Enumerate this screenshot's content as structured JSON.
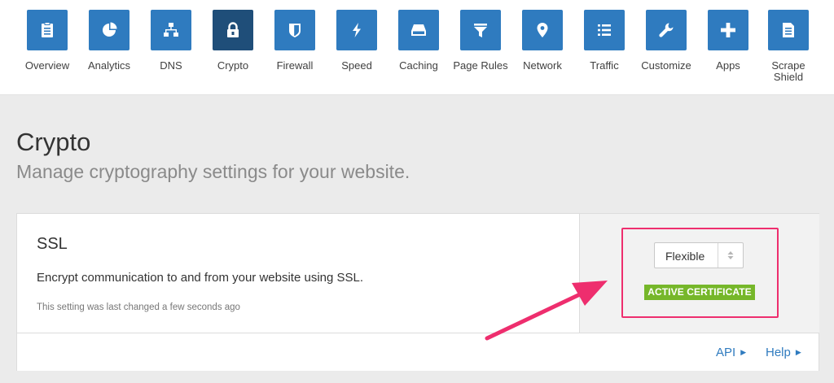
{
  "nav": {
    "items": [
      {
        "label": "Overview",
        "icon": "clipboard-icon"
      },
      {
        "label": "Analytics",
        "icon": "pie-chart-icon"
      },
      {
        "label": "DNS",
        "icon": "sitemap-icon"
      },
      {
        "label": "Crypto",
        "icon": "lock-icon"
      },
      {
        "label": "Firewall",
        "icon": "shield-icon"
      },
      {
        "label": "Speed",
        "icon": "lightning-icon"
      },
      {
        "label": "Caching",
        "icon": "hard-drive-icon"
      },
      {
        "label": "Page Rules",
        "icon": "filter-icon"
      },
      {
        "label": "Network",
        "icon": "map-pin-icon"
      },
      {
        "label": "Traffic",
        "icon": "list-icon"
      },
      {
        "label": "Customize",
        "icon": "wrench-icon"
      },
      {
        "label": "Apps",
        "icon": "plus-icon"
      },
      {
        "label": "Scrape Shield",
        "icon": "document-icon"
      }
    ],
    "active": "Crypto"
  },
  "page": {
    "title": "Crypto",
    "subtitle": "Manage cryptography settings for your website."
  },
  "ssl_card": {
    "title": "SSL",
    "description": "Encrypt communication to and from your website using SSL.",
    "last_changed": "This setting was last changed a few seconds ago",
    "select_value": "Flexible",
    "badge": "ACTIVE CERTIFICATE",
    "footer": {
      "api_label": "API",
      "help_label": "Help"
    }
  },
  "colors": {
    "nav_tile": "#2f7bbf",
    "nav_tile_active": "#1f4e79",
    "badge": "#76b72a",
    "annotation": "#ee2e6e",
    "link": "#2f7bbf"
  }
}
